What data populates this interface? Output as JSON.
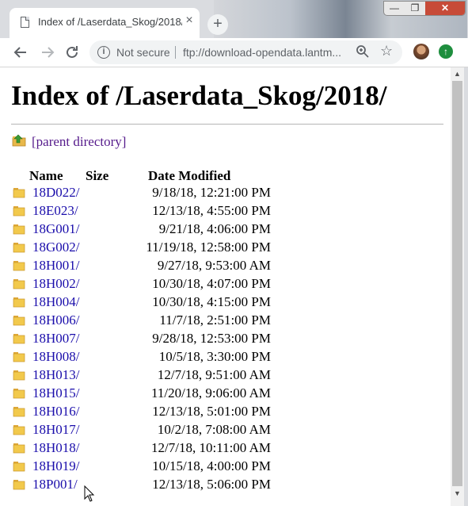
{
  "browser": {
    "tab_title": "Index of /Laserdata_Skog/2018/",
    "tab_close": "×",
    "new_tab": "+",
    "security_label": "Not secure",
    "url": "ftp://download-opendata.lantm...",
    "window_controls": {
      "minimize": "—",
      "maximize": "❐",
      "close": "✕"
    }
  },
  "page": {
    "heading": "Index of /Laserdata_Skog/2018/",
    "parent_link": "[parent directory]",
    "columns": {
      "name": "Name",
      "size": "Size",
      "date": "Date Modified"
    },
    "entries": [
      {
        "name": "18D022/",
        "date": "9/18/18, 12:21:00 PM"
      },
      {
        "name": "18E023/",
        "date": "12/13/18, 4:55:00 PM"
      },
      {
        "name": "18G001/",
        "date": "9/21/18, 4:06:00 PM"
      },
      {
        "name": "18G002/",
        "date": "11/19/18, 12:58:00 PM"
      },
      {
        "name": "18H001/",
        "date": "9/27/18, 9:53:00 AM"
      },
      {
        "name": "18H002/",
        "date": "10/30/18, 4:07:00 PM"
      },
      {
        "name": "18H004/",
        "date": "10/30/18, 4:15:00 PM"
      },
      {
        "name": "18H006/",
        "date": "11/7/18, 2:51:00 PM"
      },
      {
        "name": "18H007/",
        "date": "9/28/18, 12:53:00 PM"
      },
      {
        "name": "18H008/",
        "date": "10/5/18, 3:30:00 PM"
      },
      {
        "name": "18H013/",
        "date": "12/7/18, 9:51:00 AM"
      },
      {
        "name": "18H015/",
        "date": "11/20/18, 9:06:00 AM"
      },
      {
        "name": "18H016/",
        "date": "12/13/18, 5:01:00 PM"
      },
      {
        "name": "18H017/",
        "date": "10/2/18, 7:08:00 AM"
      },
      {
        "name": "18H018/",
        "date": "12/7/18, 10:11:00 AM"
      },
      {
        "name": "18H019/",
        "date": "10/15/18, 4:00:00 PM"
      },
      {
        "name": "18P001/",
        "date": "12/13/18, 5:06:00 PM"
      }
    ]
  },
  "colors": {
    "link": "#1a0dab",
    "visited_link": "#551a8b",
    "folder": "#f2c94c",
    "chrome_frame": "#dadce0"
  },
  "icons": {
    "tab": "page-icon",
    "back": "arrow-left-icon",
    "forward": "arrow-right-icon",
    "reload": "reload-icon",
    "info": "info-icon",
    "zoom": "zoom-icon",
    "bookmark": "star-icon",
    "profile": "avatar",
    "extension": "extension-icon",
    "parent": "parent-folder-icon",
    "entry": "folder-icon"
  }
}
